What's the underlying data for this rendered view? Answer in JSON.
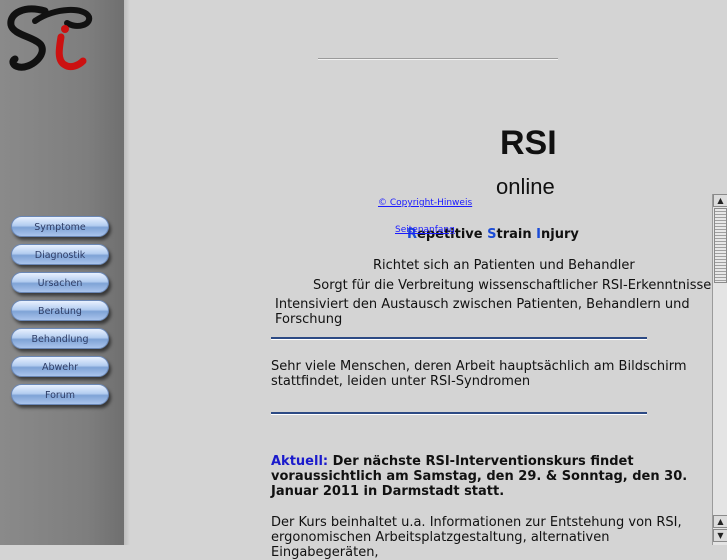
{
  "sidebar": {
    "logo_alt": "Si",
    "nav": [
      {
        "label": "Symptome"
      },
      {
        "label": "Diagnostik"
      },
      {
        "label": "Ursachen"
      },
      {
        "label": "Beratung"
      },
      {
        "label": "Behandlung"
      },
      {
        "label": "Abwehr"
      },
      {
        "label": "Forum"
      }
    ]
  },
  "main": {
    "title": "RSI",
    "subtitle": "online",
    "copyright_link": "© Copyright-Hinweis",
    "top_link": "Seitenanfang",
    "expansion": {
      "r_cap": "R",
      "r_rest": "epetitive ",
      "s_cap": "S",
      "s_rest": "train ",
      "i_cap": "I",
      "i_rest": "njury"
    },
    "points": [
      "Richtet sich an Patienten und Behandler",
      "Sorgt für die Verbreitung wissenschaftlicher RSI-Erkenntnisse",
      "Intensiviert den Austausch zwischen Patienten, Behandlern und Forschung"
    ],
    "intro": "Sehr viele Menschen, deren Arbeit hauptsächlich am Bildschirm stattfindet, leiden unter RSI-Syndromen",
    "news_label": "Aktuell:",
    "news_text": " Der nächste RSI-Interventionskurs findet voraussichtlich am Samstag, den 29. & Sonntag, den 30. Januar 2011 in Darmstadt statt.",
    "course_text": "Der Kurs beinhaltet u.a. Informationen zur Entstehung von RSI, ergonomischen Arbeitsplatzgestaltung, alternativen Eingabegeräten,"
  },
  "colors": {
    "accent_blue": "#1a1acc",
    "rule_blue": "#2c4a84",
    "nav_text": "#2e3d66"
  }
}
